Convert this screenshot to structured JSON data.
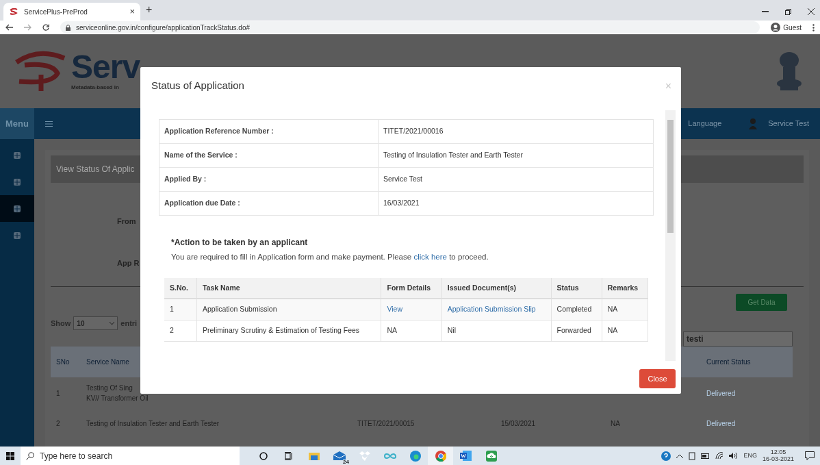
{
  "browser": {
    "tab_title": "ServicePlus-PreProd",
    "tab_close": "×",
    "new_tab": "+",
    "url": "serviceonline.gov.in/configure/applicationTrackStatus.do#",
    "profile": "Guest"
  },
  "header": {
    "logo_text": "Serv",
    "tagline": "Metadata-based In"
  },
  "navbar": {
    "menu": "Menu",
    "language": "Language",
    "user": "Service Test"
  },
  "sidebar": {
    "items": [
      {
        "selected": false
      },
      {
        "selected": false
      },
      {
        "selected": true
      },
      {
        "selected": false
      }
    ]
  },
  "page": {
    "breadcrumb": "View Status Of Applic",
    "from_label": "From",
    "app_ref_label": "App R",
    "get_data": "Get Data",
    "show_label": "Show",
    "page_size": "10",
    "entries_label": "entri",
    "search_value": "testi",
    "columns": {
      "sno": "SNo",
      "service_name": "Service Name",
      "status": "Current Status"
    },
    "rows": [
      {
        "sno": "1",
        "service_lines": [
          "Testing Of Sing",
          "KV// Transformer Oil"
        ],
        "status": "Delivered"
      },
      {
        "sno": "2",
        "service_lines": [
          "Testing of Insulation Tester and Earth Tester"
        ],
        "ref": "TITET/2021/00015",
        "date": "15/03/2021",
        "remarks": "NA",
        "status": "Delivered"
      }
    ]
  },
  "modal": {
    "title": "Status of Application",
    "close_x": "×",
    "info": [
      {
        "label": "Application Reference Number :",
        "value": "TITET/2021/00016"
      },
      {
        "label": "Name of the Service :",
        "value": "Testing of Insulation Tester and Earth Tester"
      },
      {
        "label": "Applied By :",
        "value": "Service Test"
      },
      {
        "label": "Application due Date :",
        "value": "16/03/2021"
      }
    ],
    "action_heading": "*Action to be taken by an applicant",
    "action_text": {
      "before": "You are required to fill in Application form and make payment. Please ",
      "link": "click here",
      "after": " to proceed."
    },
    "task_columns": [
      "S.No.",
      "Task Name",
      "Form Details",
      "Issued Document(s)",
      "Status",
      "Remarks"
    ],
    "tasks": [
      {
        "sno": "1",
        "task": "Application Submission",
        "form": {
          "text": "View",
          "link": true
        },
        "document": {
          "text": "Application Submission Slip",
          "link": true
        },
        "status": "Completed",
        "remarks": "NA"
      },
      {
        "sno": "2",
        "task": "Preliminary Scrutiny & Estimation of Testing Fees",
        "form": {
          "text": "NA",
          "link": false
        },
        "document": {
          "text": "Nil",
          "link": false
        },
        "status": "Forwarded",
        "remarks": "NA"
      }
    ],
    "close_button": "Close"
  },
  "taskbar": {
    "search_placeholder": "Type here to search",
    "mail_badge": "24",
    "language": "ENG",
    "time": "12:05",
    "date": "16-03-2021"
  }
}
